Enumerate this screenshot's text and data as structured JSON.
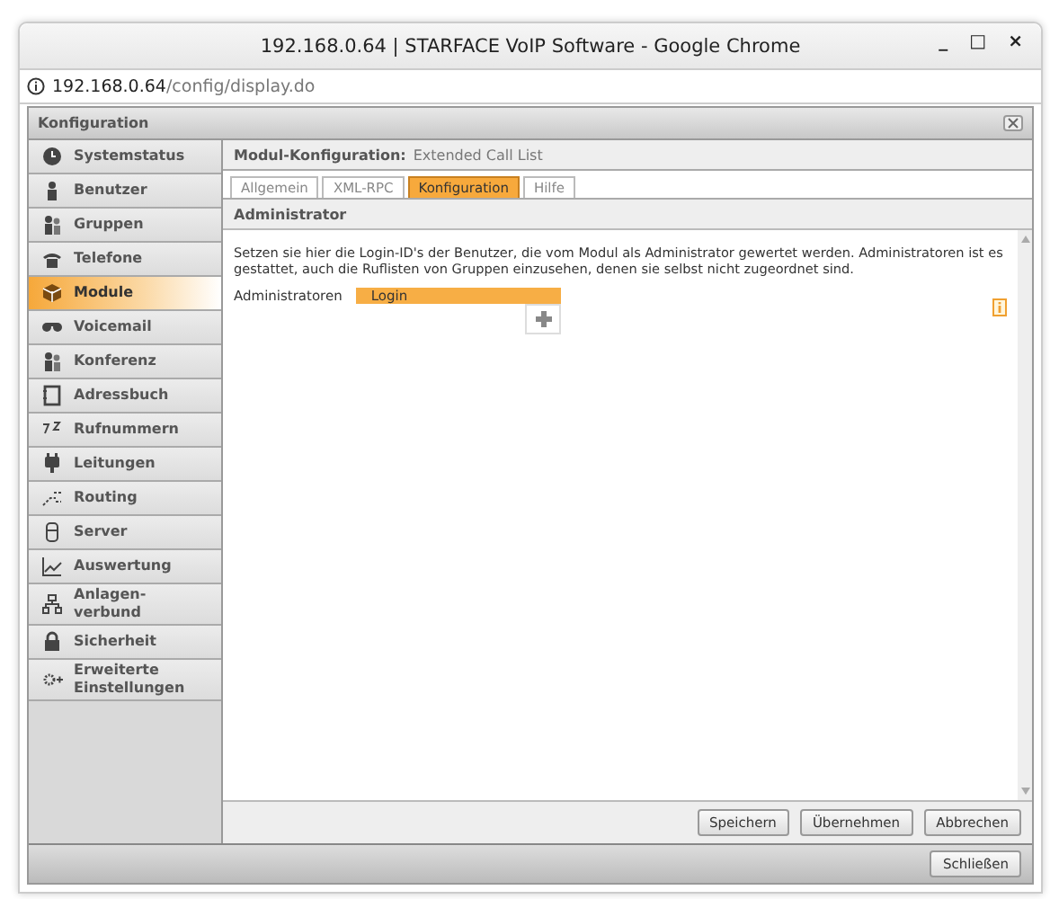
{
  "window": {
    "title": "192.168.0.64 | STARFACE VoIP Software - Google Chrome",
    "controls": [
      "_",
      "□",
      "×"
    ]
  },
  "address_bar": {
    "host": "192.168.0.64",
    "path": "/config/display.do"
  },
  "panel": {
    "title": "Konfiguration"
  },
  "sidebar": {
    "items": [
      {
        "label": "Systemstatus",
        "selected": false
      },
      {
        "label": "Benutzer",
        "selected": false
      },
      {
        "label": "Gruppen",
        "selected": false
      },
      {
        "label": "Telefone",
        "selected": false
      },
      {
        "label": "Module",
        "selected": true
      },
      {
        "label": "Voicemail",
        "selected": false
      },
      {
        "label": "Konferenz",
        "selected": false
      },
      {
        "label": "Adressbuch",
        "selected": false
      },
      {
        "label": "Rufnummern",
        "selected": false
      },
      {
        "label": "Leitungen",
        "selected": false
      },
      {
        "label": "Routing",
        "selected": false
      },
      {
        "label": "Server",
        "selected": false
      },
      {
        "label": "Auswertung",
        "selected": false
      },
      {
        "label": "Anlagen-verbund",
        "selected": false
      },
      {
        "label": "Sicherheit",
        "selected": false
      },
      {
        "label": "Erweiterte Einstellungen",
        "selected": false
      }
    ]
  },
  "module_header": {
    "label": "Modul-Konfiguration:",
    "value": "Extended Call List"
  },
  "tabs": [
    {
      "label": "Allgemein",
      "selected": false
    },
    {
      "label": "XML-RPC",
      "selected": false
    },
    {
      "label": "Konfiguration",
      "selected": true
    },
    {
      "label": "Hilfe",
      "selected": false
    }
  ],
  "section": {
    "title": "Administrator",
    "description": "Setzen sie hier die Login-ID's der Benutzer, die vom Modul als Administrator gewertet werden. Administratoren ist es gestattet, auch die Ruflisten von Gruppen einzusehen, denen sie selbst nicht zugeordnet sind.",
    "field_label": "Administratoren",
    "column": "Login"
  },
  "buttons": [
    "Speichern",
    "Übernehmen",
    "Abbrechen"
  ],
  "footer_button": "Schließen"
}
